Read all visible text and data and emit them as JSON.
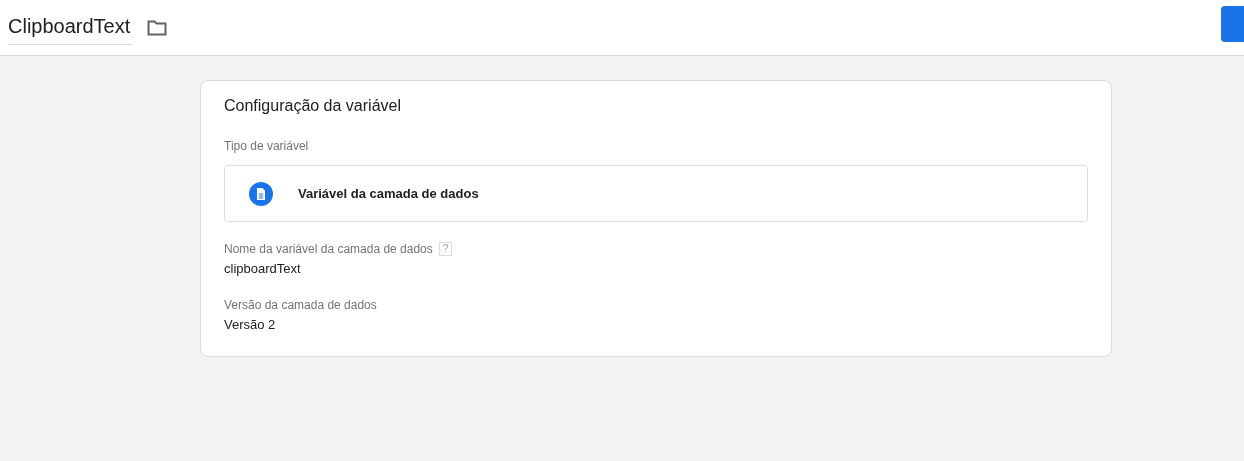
{
  "header": {
    "title": "ClipboardText"
  },
  "card": {
    "title": "Configuração da variável",
    "type_label": "Tipo de variável",
    "type_value": "Variável da camada de dados",
    "fields": [
      {
        "label": "Nome da variável da camada de dados",
        "help": "?",
        "value": "clipboardText"
      },
      {
        "label": "Versão da camada de dados",
        "value": "Versão 2"
      }
    ]
  }
}
